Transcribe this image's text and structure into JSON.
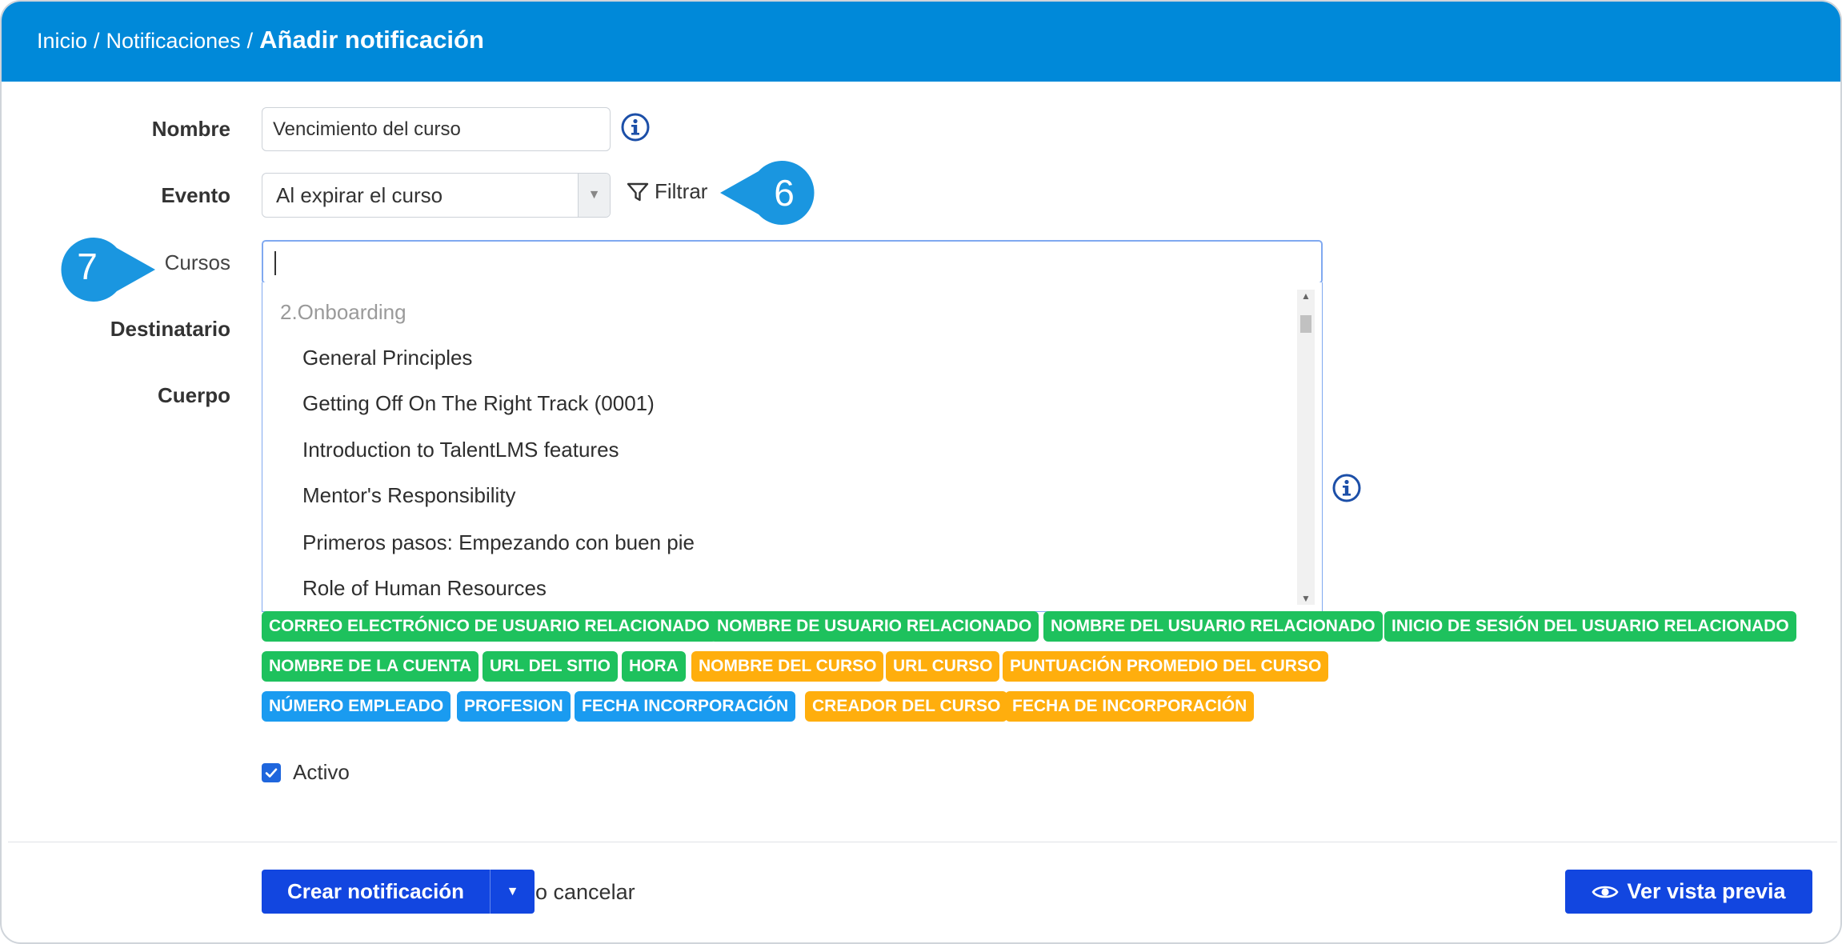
{
  "breadcrumb": {
    "home": "Inicio",
    "separator": "/",
    "notifications": "Notificaciones",
    "current": "Añadir notificación"
  },
  "form": {
    "name_label": "Nombre",
    "name_value": "Vencimiento del curso",
    "event_label": "Evento",
    "event_value": "Al expirar el curso",
    "filter_label": "Filtrar",
    "courses_label": "Cursos",
    "recipient_label": "Destinatario",
    "body_label": "Cuerpo",
    "active_label": "Activo",
    "active_checked": true
  },
  "callouts": {
    "six": "6",
    "seven": "7"
  },
  "dropdown": {
    "group": "2.Onboarding",
    "items": [
      "General Principles",
      "Getting Off On The Right Track (0001)",
      "Introduction to TalentLMS features",
      "Mentor's Responsibility",
      "Primeros pasos: Empezando con buen pie",
      "Role of Human Resources"
    ]
  },
  "tags": {
    "row1": [
      "CORREO ELECTRÓNICO DE USUARIO RELACIONADO",
      "NOMBRE DE USUARIO RELACIONADO",
      "NOMBRE DEL USUARIO RELACIONADO",
      "INICIO DE SESIÓN DEL USUARIO RELACIONADO"
    ],
    "row2": [
      "NOMBRE DE LA CUENTA",
      "URL DEL SITIO",
      "HORA",
      "NOMBRE DEL CURSO",
      "URL CURSO",
      "PUNTUACIÓN PROMEDIO DEL CURSO"
    ],
    "row3": [
      "NÚMERO EMPLEADO",
      "PROFESION",
      "FECHA INCORPORACIÓN",
      "CREADOR DEL CURSO",
      "FECHA DE INCORPORACIÓN"
    ]
  },
  "footer": {
    "create_label": "Crear notificación",
    "cancel_label": "o cancelar",
    "preview_label": "Ver vista previa"
  },
  "colors": {
    "header": "#0089d9",
    "callout": "#1a96e0",
    "primary_button": "#1246e0",
    "tag_green": "#1ec15d",
    "tag_orange": "#ffae0d",
    "tag_blue": "#1a9bf0"
  }
}
